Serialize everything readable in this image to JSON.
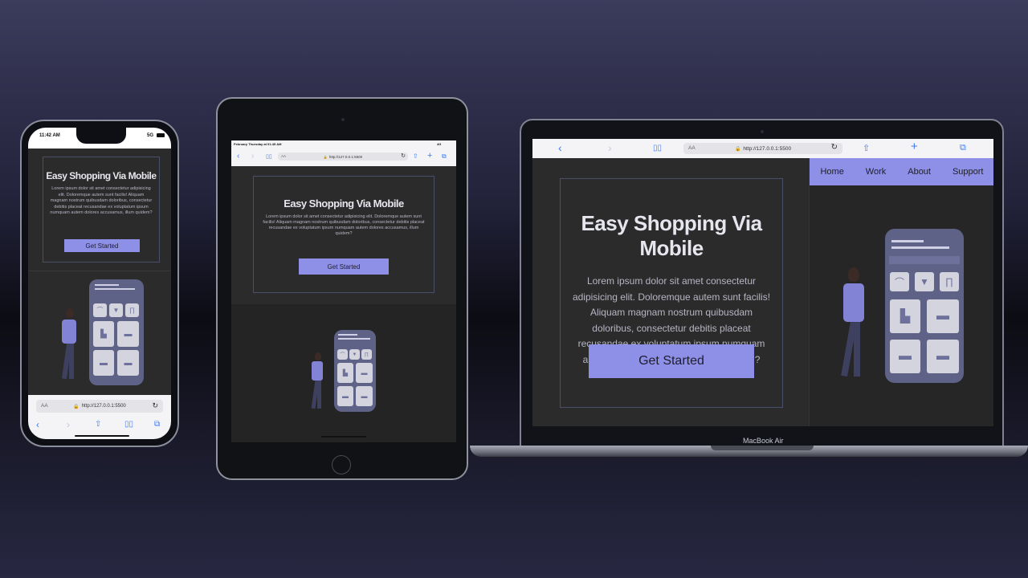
{
  "app": {
    "headline": "Easy Shopping Via Mobile",
    "body": "Lorem ipsum dolor sit amet consectetur adipisicing elit. Doloremque autem sunt facilis! Aliquam magnam nostrum quibusdam doloribus, consectetur debitis placeat recusandae ex voluptatum ipsum numquam autem dolores accusamus, illum quidem?",
    "cta_label": "Get Started",
    "nav": [
      "Home",
      "Work",
      "About",
      "Support"
    ]
  },
  "phone": {
    "time": "11:42 AM",
    "signal": "5G",
    "url": "http://127.0.0.1:5500",
    "aa": "AA"
  },
  "ipad": {
    "status_date": "February Thursday at 01:45 AM",
    "status_right": "4G",
    "url": "http://127.0.0.1:5500",
    "aa": "AA"
  },
  "mac": {
    "url": "http://127.0.0.1:5500",
    "aa": "AA",
    "model_label": "MacBook Air"
  },
  "colors": {
    "accent": "#8e90e8",
    "screen_bg": "#2b2b2b",
    "browser_blue": "#3d7bf5"
  },
  "icons": {
    "back": "chevron-left-icon",
    "forward": "chevron-right-icon",
    "bookmarks": "book-icon",
    "reload": "reload-icon",
    "share": "share-icon",
    "new_tab": "plus-icon",
    "tabs": "tabs-icon",
    "lock": "lock-icon"
  }
}
